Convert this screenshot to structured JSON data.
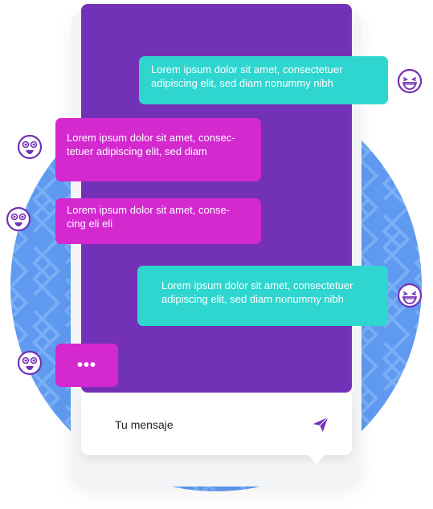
{
  "colors": {
    "background_circle": "#5f9af0",
    "phone_screen": "#7331b7",
    "teal_bubble": "#2fd6cf",
    "magenta_bubble": "#d329cf",
    "icon_stroke": "#7331b7"
  },
  "messages": [
    {
      "side": "right",
      "color": "teal",
      "lines": [
        "Lorem ipsum dolor sit amet, consectetuer",
        "adipiscing elit, sed diam nonummy nibh"
      ],
      "avatar": "laughing-face-icon"
    },
    {
      "side": "left",
      "color": "magenta",
      "lines": [
        "Lorem ipsum dolor sit amet, consec-",
        "tetuer adipiscing elit, sed diam"
      ],
      "avatar": "surprised-face-icon"
    },
    {
      "side": "left",
      "color": "magenta",
      "lines": [
        "Lorem ipsum dolor sit amet, conse-",
        "cing eli eli"
      ],
      "avatar": "surprised-face-icon"
    },
    {
      "side": "right",
      "color": "teal",
      "lines": [
        "Lorem ipsum dolor sit amet, consectetuer",
        "adipiscing elit, sed diam nonummy nibh"
      ],
      "avatar": "laughing-face-icon"
    },
    {
      "side": "left",
      "color": "magenta",
      "typing": "•••",
      "avatar": "surprised-face-icon"
    }
  ],
  "input": {
    "placeholder": "Tu mensaje",
    "send_icon": "send-icon"
  }
}
